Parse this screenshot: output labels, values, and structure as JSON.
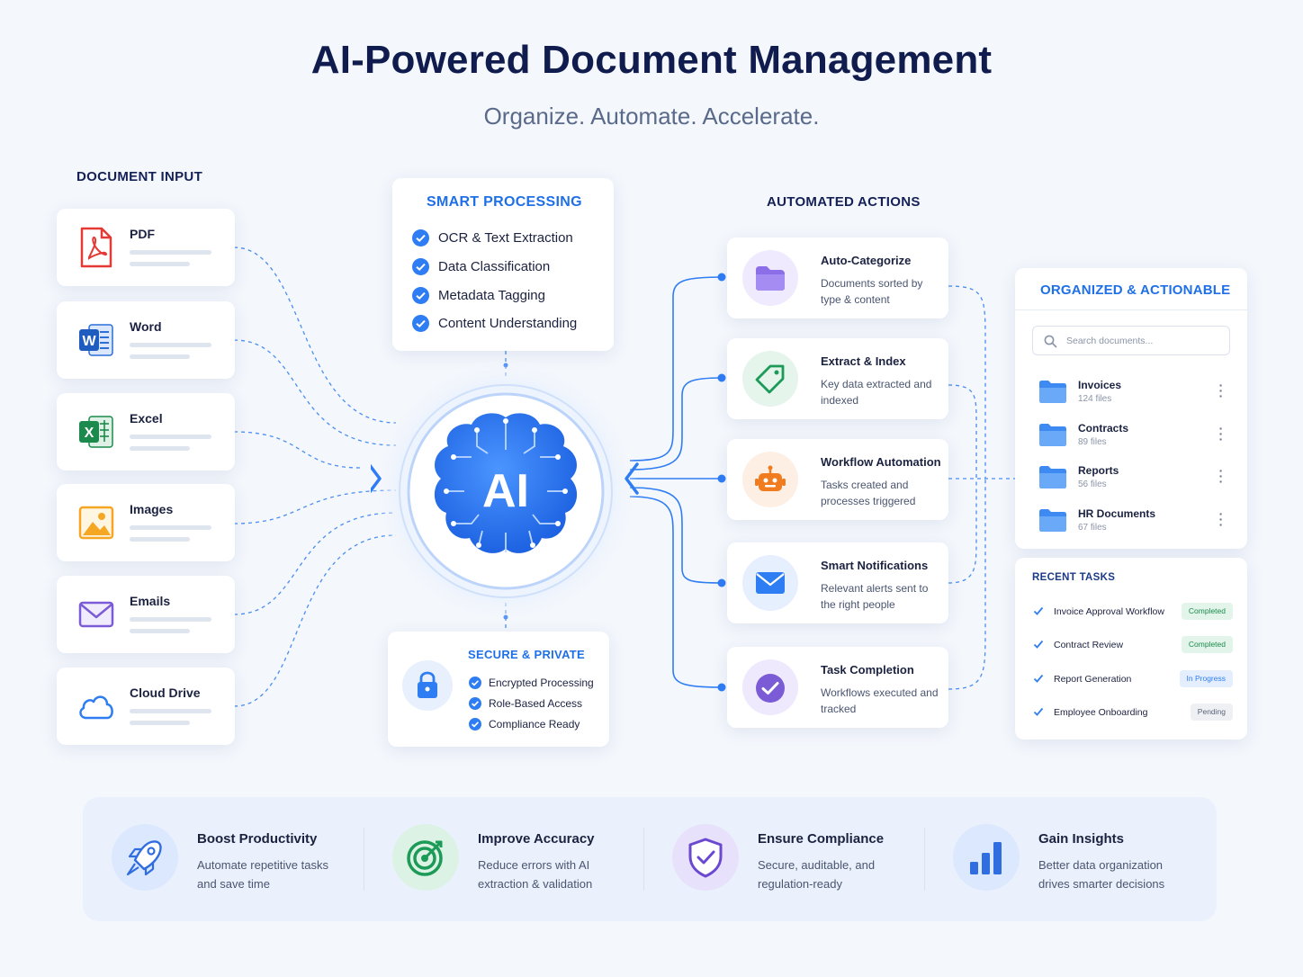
{
  "header": {
    "title": "AI-Powered Document Management",
    "subtitle": "Organize. Automate. Accelerate."
  },
  "document_input": {
    "label": "DOCUMENT INPUT",
    "items": [
      {
        "name": "PDF",
        "icon": "pdf-file-icon",
        "color": "#e53935"
      },
      {
        "name": "Word",
        "icon": "word-file-icon",
        "color": "#1e5dbf"
      },
      {
        "name": "Excel",
        "icon": "excel-file-icon",
        "color": "#1b8a4c"
      },
      {
        "name": "Images",
        "icon": "image-file-icon",
        "color": "#f5a623"
      },
      {
        "name": "Emails",
        "icon": "email-icon",
        "color": "#7b5cd6"
      },
      {
        "name": "Cloud Drive",
        "icon": "cloud-icon",
        "color": "#2f7df3"
      }
    ]
  },
  "smart_processing": {
    "label": "SMART PROCESSING",
    "items": [
      "OCR & Text Extraction",
      "Data Classification",
      "Metadata Tagging",
      "Content Understanding"
    ]
  },
  "ai_core": {
    "text": "AI",
    "icon": "ai-brain-icon"
  },
  "secure": {
    "label": "SECURE & PRIVATE",
    "items": [
      "Encrypted Processing",
      "Role-Based Access",
      "Compliance Ready"
    ]
  },
  "automated_actions": {
    "label": "AUTOMATED ACTIONS",
    "items": [
      {
        "title": "Auto-Categorize",
        "desc": "Documents sorted by type & content",
        "icon": "folder-icon"
      },
      {
        "title": "Extract & Index",
        "desc": "Key data extracted and indexed",
        "icon": "tag-icon"
      },
      {
        "title": "Workflow Automation",
        "desc": "Tasks created and processes triggered",
        "icon": "robot-icon"
      },
      {
        "title": "Smart Notifications",
        "desc": "Relevant alerts sent to the right people",
        "icon": "envelope-icon"
      },
      {
        "title": "Task Completion",
        "desc": "Workflows executed and tracked",
        "icon": "check-circle-icon"
      }
    ]
  },
  "organized": {
    "label": "ORGANIZED & ACTIONABLE",
    "search_placeholder": "Search documents...",
    "folders": [
      {
        "name": "Invoices",
        "count": "124 files"
      },
      {
        "name": "Contracts",
        "count": "89 files"
      },
      {
        "name": "Reports",
        "count": "56 files"
      },
      {
        "name": "HR Documents",
        "count": "67 files"
      }
    ],
    "recent_label": "RECENT TASKS",
    "tasks": [
      {
        "name": "Invoice Approval Workflow",
        "status": "Completed",
        "status_color": "#1b8a4c"
      },
      {
        "name": "Contract Review",
        "status": "Completed",
        "status_color": "#1b8a4c"
      },
      {
        "name": "Report Generation",
        "status": "In Progress",
        "status_color": "#2f7df3"
      },
      {
        "name": "Employee Onboarding",
        "status": "Pending",
        "status_color": "#5a6478"
      }
    ]
  },
  "benefits": [
    {
      "title": "Boost Productivity",
      "desc": "Automate repetitive tasks and save time",
      "icon": "rocket-icon"
    },
    {
      "title": "Improve Accuracy",
      "desc": "Reduce errors with AI extraction & validation",
      "icon": "target-icon"
    },
    {
      "title": "Ensure Compliance",
      "desc": "Secure, auditable, and regulation-ready",
      "icon": "shield-check-icon"
    },
    {
      "title": "Gain Insights",
      "desc": "Better data organization drives smarter decisions",
      "icon": "bar-chart-icon"
    }
  ],
  "colors": {
    "primary": "#2f7df3",
    "navy": "#101c4e",
    "background": "#f4f7fc"
  }
}
